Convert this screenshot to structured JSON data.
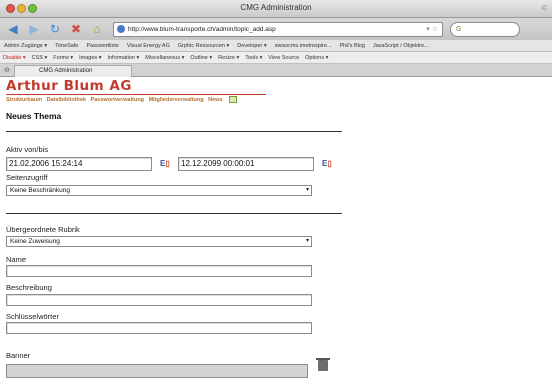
{
  "window": {
    "title": "CMG Administration"
  },
  "nav": {
    "url": "http://www.blum-transporte.ch/admin/topic_add.asp",
    "search_placeholder": "G"
  },
  "bookmarks": [
    "Admin Zugänge ▾",
    "TimeSafe",
    "Passwortliste",
    "Visual Energy AG",
    "Grphic Ressourcen ▾",
    "Developer ▾",
    "swisscms.imetrospire...",
    "Phil's Blog",
    "JavaScript / Objektre..."
  ],
  "toolbar": [
    "Disable ▾",
    "CSS ▾",
    "Forms ▾",
    "Images ▾",
    "Information ▾",
    "Miscellaneous ▾",
    "Outline ▾",
    "Resize ▾",
    "Tools ▾",
    "View Source",
    "Options ▾"
  ],
  "tab": {
    "label": "CMG Administration"
  },
  "page": {
    "logo": "Arthur Blum AG",
    "menu": [
      "Strukturbaum",
      "Dateibibliothek",
      "Passwortverwaltung",
      "Mitgliederverwaltung",
      "News"
    ],
    "heading": "Neues Thema",
    "active_label": "Aktiv von/bis",
    "active_from": "21.02.2006 15:24:14",
    "active_to": "12.12.2099 00:00:01",
    "calendar_label": "E",
    "access_label": "Seitenzugriff",
    "access_value": "Keine Beschränkung",
    "parent_label": "Übergeordnete Rubrik",
    "parent_value": "Keine Zuweisung",
    "name_label": "Name",
    "name_value": "",
    "description_label": "Beschreibung",
    "description_value": "",
    "keywords_label": "Schlüsselwörter",
    "keywords_value": "",
    "banner_label": "Banner"
  }
}
